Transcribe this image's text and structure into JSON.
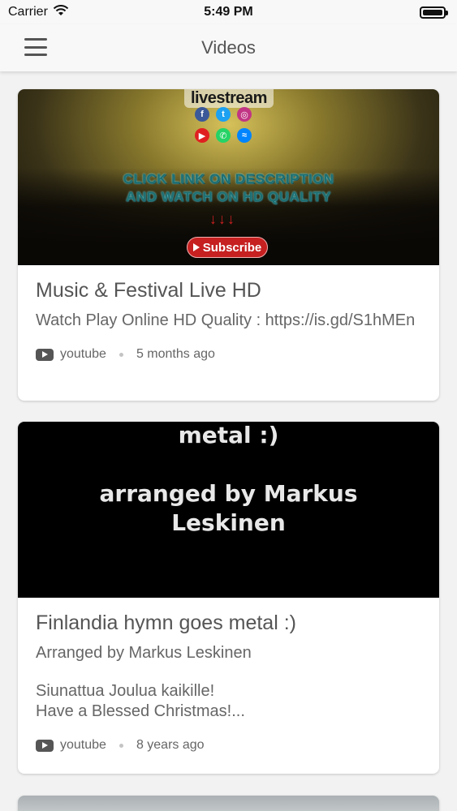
{
  "status_bar": {
    "carrier": "Carrier",
    "time": "5:49 PM"
  },
  "nav": {
    "title": "Videos"
  },
  "videos": [
    {
      "thumbnail": {
        "logo_text": "livestream",
        "caption_line1": "CLICK LINK ON DESCRIPTION",
        "caption_line2": "AND WATCH ON HD QUALITY",
        "subscribe_label": "Subscribe"
      },
      "title": "Music & Festival Live HD",
      "description": "Watch Play Online HD Quality : https://is.gd/S1hMEn",
      "source": "youtube",
      "age": "5 months ago"
    },
    {
      "thumbnail": {
        "line1": "metal :)",
        "line2": "arranged by Markus",
        "line3": "Leskinen"
      },
      "title": "Finlandia hymn goes metal :)",
      "description_line1": "Arranged by Markus Leskinen",
      "description_line2": "Siunattua Joulua kaikille!",
      "description_line3": "Have a Blessed Christmas!...",
      "source": "youtube",
      "age": "8 years ago"
    }
  ],
  "colors": {
    "background": "#f2f2f2",
    "card": "#ffffff",
    "text": "#555555",
    "subscribe_red": "#c62020"
  }
}
